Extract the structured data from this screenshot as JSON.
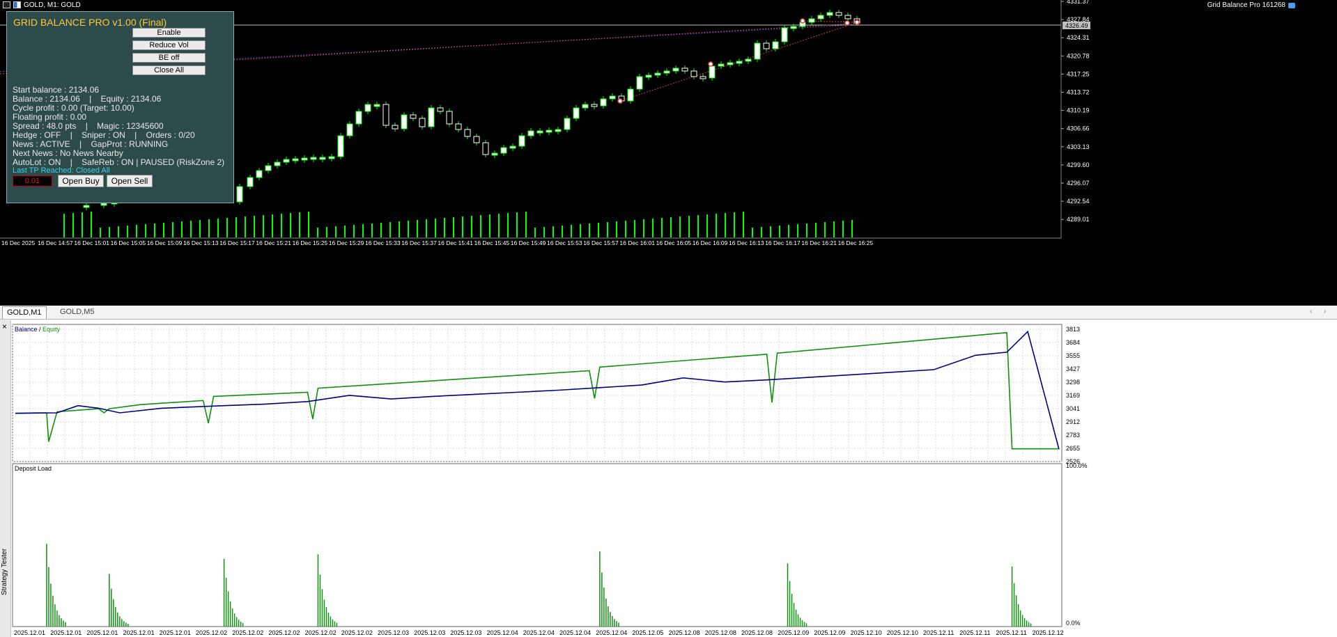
{
  "chart_window": {
    "title": "GOLD, M1:  GOLD",
    "ea_label": "Grid Balance Pro 161268",
    "price_ticks": [
      "4331.37",
      "4327.84",
      "4324.31",
      "4320.78",
      "4317.25",
      "4313.72",
      "4310.19",
      "4306.66",
      "4303.13",
      "4299.60",
      "4296.07",
      "4292.54",
      "4289.01"
    ],
    "current_price": "4326.49",
    "time_ticks": [
      "16 Dec 2025",
      "16 Dec 14:57",
      "16 Dec 15:01",
      "16 Dec 15:05",
      "16 Dec 15:09",
      "16 Dec 15:13",
      "16 Dec 15:17",
      "16 Dec 15:21",
      "16 Dec 15:25",
      "16 Dec 15:29",
      "16 Dec 15:33",
      "16 Dec 15:37",
      "16 Dec 15:41",
      "16 Dec 15:45",
      "16 Dec 15:49",
      "16 Dec 15:53",
      "16 Dec 15:57",
      "16 Dec 16:01",
      "16 Dec 16:05",
      "16 Dec 16:09",
      "16 Dec 16:13",
      "16 Dec 16:17",
      "16 Dec 16:21",
      "16 Dec 16:25"
    ],
    "colors": {
      "background": "#000000",
      "bull": "#ffffff",
      "bear": "#ffffff",
      "wick": "#00ff00",
      "volume": "#00ff00",
      "trade_line": "#d04040",
      "grid_line": "#5050d0"
    }
  },
  "ea_panel": {
    "title": "GRID BALANCE PRO v1.00 (Final)",
    "buttons": [
      "Enable",
      "Reduce Vol",
      "BE off",
      "Close All"
    ],
    "lines": [
      "Start balance : 2134.06",
      "Balance : 2134.06    |    Equity : 2134.06",
      "Cycle profit : 0.00 (Target: 10.00)",
      "Floating profit : 0.00",
      "Spread : 48.0 pts    |    Magic : 12345600",
      "Hedge : OFF    |    Sniper : ON    |    Orders : 0/20",
      "News : ACTIVE    |    GapProt : RUNNING",
      "Next News : No News Nearby",
      "AutoLot : ON    |    SafeReb : ON | PAUSED (RiskZone 2)"
    ],
    "last_tp": "Last TP Reached: Closed All",
    "lot_value": "0.01",
    "open_buy": "Open Buy",
    "open_sell": "Open Sell",
    "colors": {
      "panel_bg": "#2e4b4b",
      "title": "#ffc83a",
      "status": "#3fd0e0",
      "lot": "#e02020"
    }
  },
  "tabs": {
    "items": [
      "GOLD,M1",
      "GOLD,M5"
    ],
    "active": 0,
    "left_arrow": "‹",
    "right_arrow": "›"
  },
  "tester": {
    "side_label": "Strategy Tester",
    "close": "×",
    "chart_data": [
      {
        "type": "line",
        "legend": [
          "Balance",
          "Equity"
        ],
        "legend_separator": " / ",
        "colors": {
          "Balance": "#000080",
          "Equity": "#109010"
        },
        "y_ticks": [
          "3813",
          "3684",
          "3555",
          "3427",
          "3298",
          "3169",
          "3041",
          "2912",
          "2783",
          "2655",
          "2526"
        ],
        "ylim": [
          2526,
          3860
        ],
        "x_count": 100,
        "series": [
          {
            "name": "Balance",
            "x": [
              0,
              4,
              6,
              8,
              10,
              14,
              20,
              24,
              28,
              32,
              36,
              40,
              44,
              48,
              52,
              56,
              60,
              64,
              68,
              72,
              76,
              80,
              84,
              88,
              92,
              95,
              97,
              100
            ],
            "values": [
              2995,
              3000,
              3070,
              3045,
              3000,
              3045,
              3070,
              3085,
              3110,
              3170,
              3135,
              3160,
              3180,
              3200,
              3220,
              3245,
              3270,
              3340,
              3300,
              3320,
              3345,
              3370,
              3395,
              3420,
              3560,
              3590,
              3790,
              2645
            ]
          },
          {
            "name": "Equity",
            "x": [
              0,
              2,
              3,
              3.2,
              4,
              8,
              8.5,
              9,
              12,
              18,
              18.5,
              19,
              28,
              28.5,
              29,
              55,
              55.5,
              56,
              72,
              72.5,
              73,
              95,
              95.5,
              96,
              100
            ],
            "values": [
              2995,
              3000,
              3000,
              2720,
              3010,
              3040,
              3000,
              3040,
              3080,
              3120,
              2900,
              3160,
              3200,
              2940,
              3240,
              3410,
              3140,
              3445,
              3570,
              3100,
              3580,
              3780,
              2650,
              2650,
              2650
            ]
          }
        ]
      },
      {
        "type": "bar",
        "title": "Deposit Load",
        "color": "#109010",
        "y_ticks": [
          "100.0%",
          "0.0%"
        ],
        "ylim": [
          0,
          100
        ],
        "x_ticks": [
          "2025.12.01",
          "2025.12.01",
          "2025.12.01",
          "2025.12.01",
          "2025.12.01",
          "2025.12.02",
          "2025.12.02",
          "2025.12.02",
          "2025.12.02",
          "2025.12.02",
          "2025.12.03",
          "2025.12.03",
          "2025.12.03",
          "2025.12.04",
          "2025.12.04",
          "2025.12.04",
          "2025.12.04",
          "2025.12.05",
          "2025.12.08",
          "2025.12.08",
          "2025.12.08",
          "2025.12.09",
          "2025.12.09",
          "2025.12.10",
          "2025.12.10",
          "2025.12.11",
          "2025.12.11",
          "2025.12.11",
          "2025.12.12"
        ],
        "clusters": [
          {
            "pos": 3,
            "peak": 55
          },
          {
            "pos": 9,
            "peak": 35
          },
          {
            "pos": 20,
            "peak": 45
          },
          {
            "pos": 29,
            "peak": 48
          },
          {
            "pos": 56,
            "peak": 50
          },
          {
            "pos": 74,
            "peak": 42
          },
          {
            "pos": 95.5,
            "peak": 40
          }
        ]
      }
    ]
  }
}
